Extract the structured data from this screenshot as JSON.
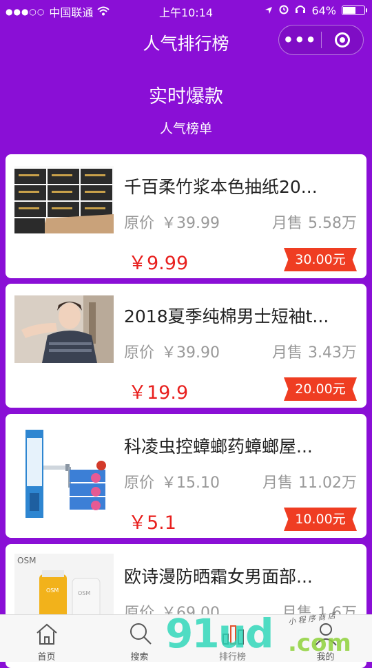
{
  "status_bar": {
    "carrier": "中国联通",
    "time": "上午10:14",
    "battery": "64%",
    "battery_level": 0.64
  },
  "nav": {
    "title": "人气排行榜",
    "more_label": "•••"
  },
  "hero": {
    "title": "实时爆款",
    "subtitle": "人气榜单"
  },
  "labels": {
    "original_price": "原价",
    "monthly_sales": "月售"
  },
  "products": [
    {
      "title": "千百柔竹浆本色抽纸20...",
      "original_price": "￥39.99",
      "sales": "5.58万",
      "price": "￥9.99",
      "coupon": "30.00元",
      "image": "tissue-boxes"
    },
    {
      "title": "2018夏季纯棉男士短袖t...",
      "original_price": "￥39.90",
      "sales": "3.43万",
      "price": "￥19.9",
      "coupon": "20.00元",
      "image": "man-polo-shirt"
    },
    {
      "title": "科凌虫控蟑螂药蟑螂屋...",
      "original_price": "￥15.10",
      "sales": "11.02万",
      "price": "￥5.1",
      "coupon": "10.00元",
      "image": "cockroach-gel"
    },
    {
      "title": "欧诗漫防晒霜女男面部...",
      "original_price": "￥69.00",
      "sales": "1.6万",
      "price": "",
      "coupon": "",
      "image": "sunscreen-bottles"
    }
  ],
  "tabbar": {
    "items": [
      {
        "label": "首页",
        "icon": "home-icon"
      },
      {
        "label": "搜索",
        "icon": "search-icon"
      },
      {
        "label": "排行榜",
        "icon": "ranking-icon"
      },
      {
        "label": "我的",
        "icon": "user-icon"
      }
    ]
  },
  "watermark": {
    "text": "91ud",
    "suffix": ".com",
    "small": "小 程 序 商 店"
  }
}
